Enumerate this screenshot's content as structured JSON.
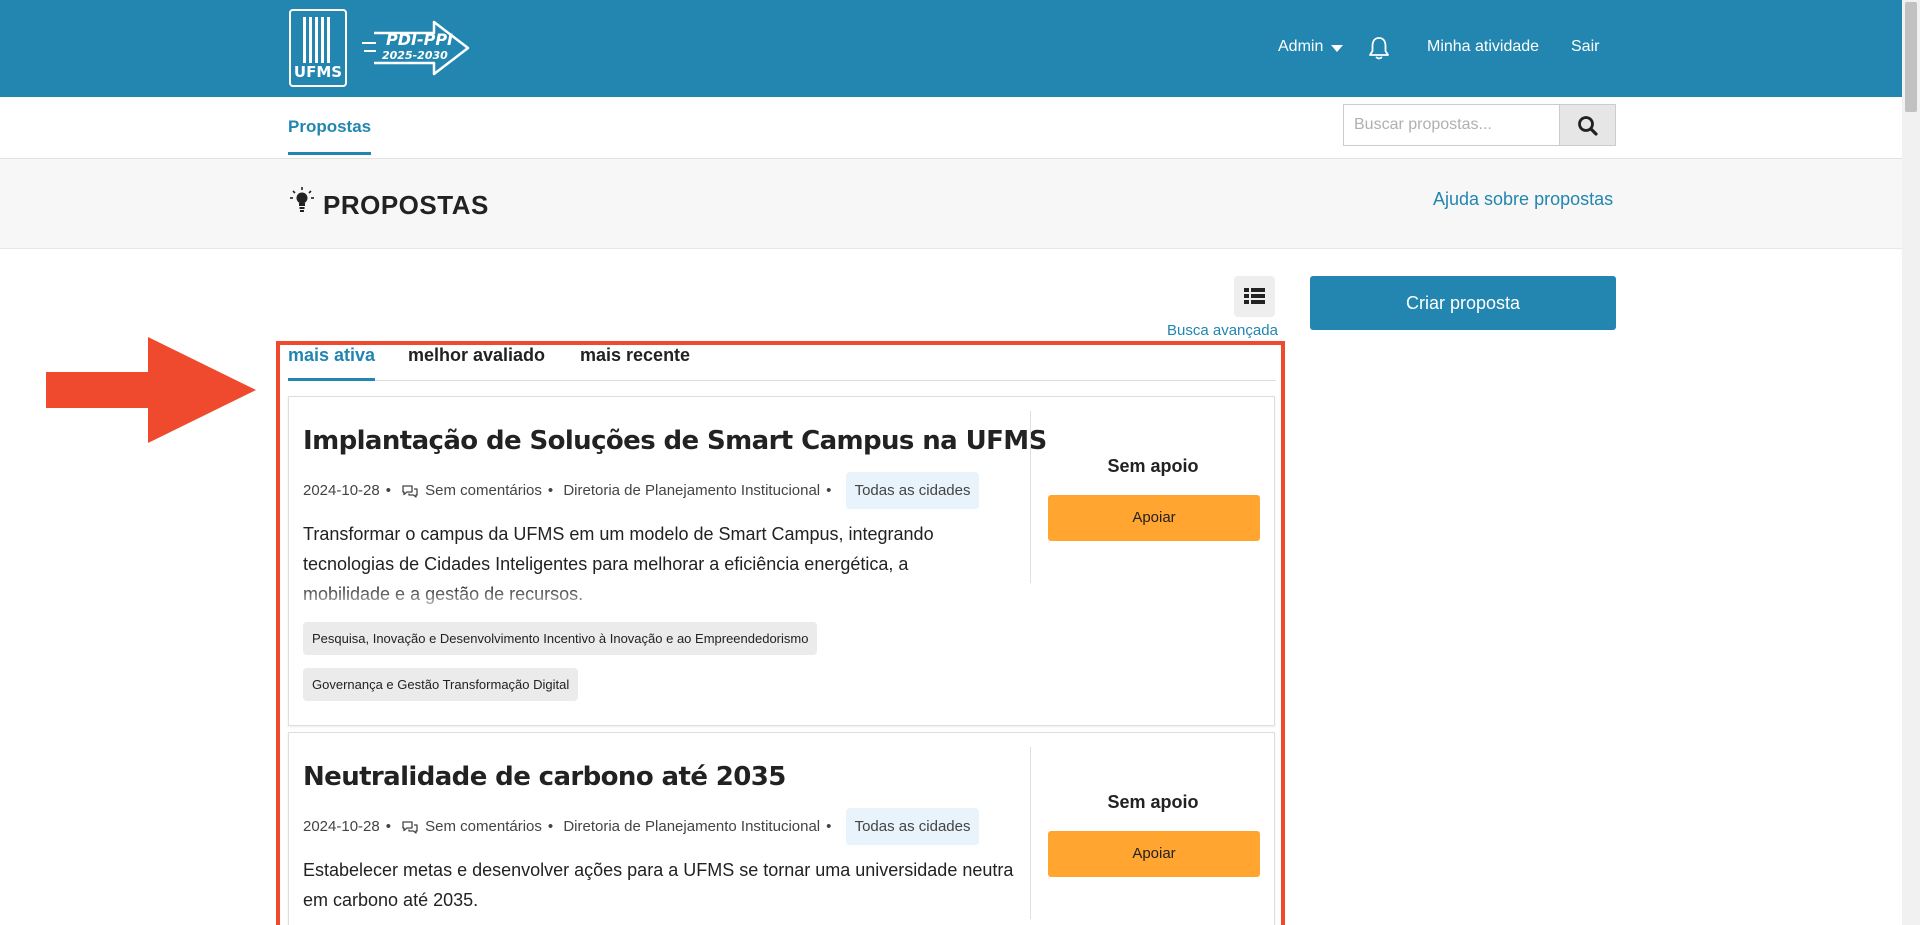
{
  "header": {
    "logo_text": "UFMS",
    "pdi_line1": "PDI-PPI",
    "pdi_line2": "2025-2030",
    "admin_label": "Admin",
    "activity_label": "Minha atividade",
    "logout_label": "Sair"
  },
  "subnav": {
    "tab_label": "Propostas",
    "search_placeholder": "Buscar propostas..."
  },
  "page": {
    "title": "PROPOSTAS",
    "help_link": "Ajuda sobre propostas",
    "advanced_search": "Busca avançada",
    "create_button": "Criar proposta"
  },
  "sort_tabs": [
    {
      "label": "mais ativa",
      "active": true
    },
    {
      "label": "melhor avaliado",
      "active": false
    },
    {
      "label": "mais recente",
      "active": false
    }
  ],
  "proposals": [
    {
      "title": "Implantação de Soluções de Smart Campus na UFMS",
      "date": "2024-10-28",
      "comments": "Sem comentários",
      "author": "Diretoria de Planejamento Institucional",
      "scope": "Todas as cidades",
      "description_line1": "Transformar o campus da UFMS em um modelo de Smart Campus, integrando",
      "description_line2": "tecnologias de Cidades Inteligentes para melhorar a eficiência energética, a",
      "description_line3": "mobilidade e a gestão de recursos.",
      "tags": [
        "Pesquisa, Inovação e Desenvolvimento Incentivo à Inovação e ao Empreendedorismo",
        "Governança e Gestão Transformação Digital"
      ],
      "support_status": "Sem apoio",
      "support_button": "Apoiar"
    },
    {
      "title": "Neutralidade de carbono até 2035",
      "date": "2024-10-28",
      "comments": "Sem comentários",
      "author": "Diretoria de Planejamento Institucional",
      "scope": "Todas as cidades",
      "description_line1": "Estabelecer metas e desenvolver ações para a UFMS se tornar uma universidade neutra",
      "description_line2": "em carbono até 2035.",
      "support_status": "Sem apoio",
      "support_button": "Apoiar"
    }
  ],
  "colors": {
    "brand": "#2286b0",
    "support_button": "#ffa530",
    "highlight": "#f04a2e"
  },
  "icons": [
    "bell-icon",
    "search-icon",
    "lightbulb-icon",
    "list-view-icon",
    "chat-icon",
    "chevron-down-icon",
    "arrow-annotation-icon"
  ]
}
